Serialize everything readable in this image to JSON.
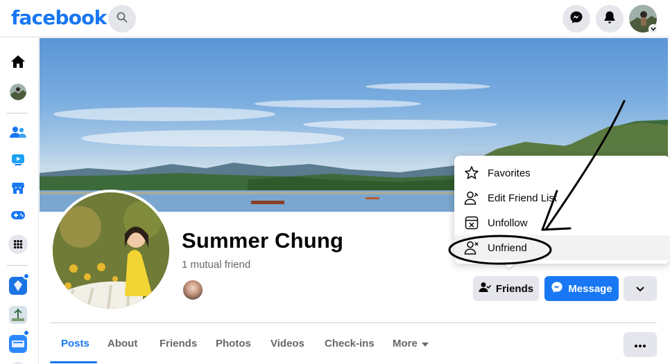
{
  "header": {
    "logo_text": "facebook",
    "icons": [
      "search-icon",
      "messenger-icon",
      "notifications-bell-icon",
      "account-avatar",
      "chevron-down-icon"
    ]
  },
  "left_rail": {
    "items": [
      "home-icon",
      "profile-avatar",
      "friends-icon",
      "watch-icon",
      "marketplace-icon",
      "gaming-icon",
      "menu-grid-icon",
      "group-shortcut-1",
      "group-shortcut-2",
      "group-shortcut-3"
    ]
  },
  "profile": {
    "name": "Summer Chung",
    "mutual_friends": "1 mutual friend"
  },
  "actions": {
    "friends_label": "Friends",
    "message_label": "Message"
  },
  "dropdown": {
    "items": [
      {
        "label": "Favorites",
        "icon": "star-icon"
      },
      {
        "label": "Edit Friend List",
        "icon": "edit-friend-list-icon"
      },
      {
        "label": "Unfollow",
        "icon": "unfollow-icon"
      },
      {
        "label": "Unfriend",
        "icon": "unfriend-icon"
      }
    ]
  },
  "tabs": [
    {
      "label": "Posts",
      "active": true
    },
    {
      "label": "About"
    },
    {
      "label": "Friends"
    },
    {
      "label": "Photos"
    },
    {
      "label": "Videos"
    },
    {
      "label": "Check-ins"
    },
    {
      "label": "More"
    }
  ],
  "colors": {
    "brand_blue": "#1877f2",
    "secondary_button": "#e4e6eb",
    "muted_text": "#65676b"
  }
}
